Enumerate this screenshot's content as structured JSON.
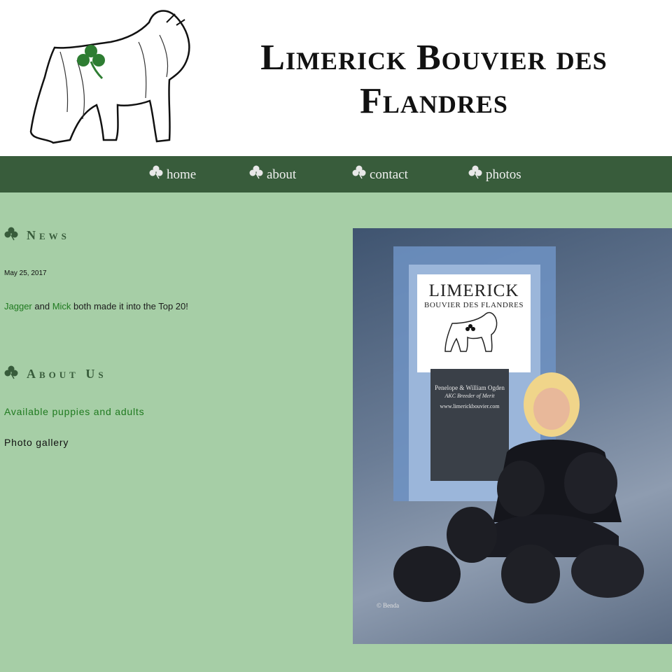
{
  "header": {
    "title_line1": "Limerick Bouvier des",
    "title_line2": "Flandres"
  },
  "nav": {
    "items": [
      {
        "label": "home"
      },
      {
        "label": "about"
      },
      {
        "label": "contact"
      },
      {
        "label": "photos"
      }
    ]
  },
  "news": {
    "title": "News",
    "date": "May 25, 2017",
    "link1": "Jagger",
    "and": "and",
    "link2": "Mick",
    "text_rest": "both made it into the Top 20!"
  },
  "about": {
    "title": "About Us",
    "link_puppies": "Available puppies and adults",
    "link_gallery": "Photo gallery"
  },
  "photo": {
    "banner_name": "LIMERICK",
    "banner_sub": "BOUVIER DES FLANDRES",
    "owners": "Penelope & William Ogden",
    "breeder": "AKC Breeder of Merit",
    "website": "www.limerickbouvier.com",
    "credit": "© Benda"
  },
  "colors": {
    "nav_bg": "#385c3b",
    "page_bg": "#a6cea6",
    "link_green": "#1f7a1f"
  },
  "icons": [
    "shamrock-icon",
    "bouvier-dog-logo"
  ]
}
